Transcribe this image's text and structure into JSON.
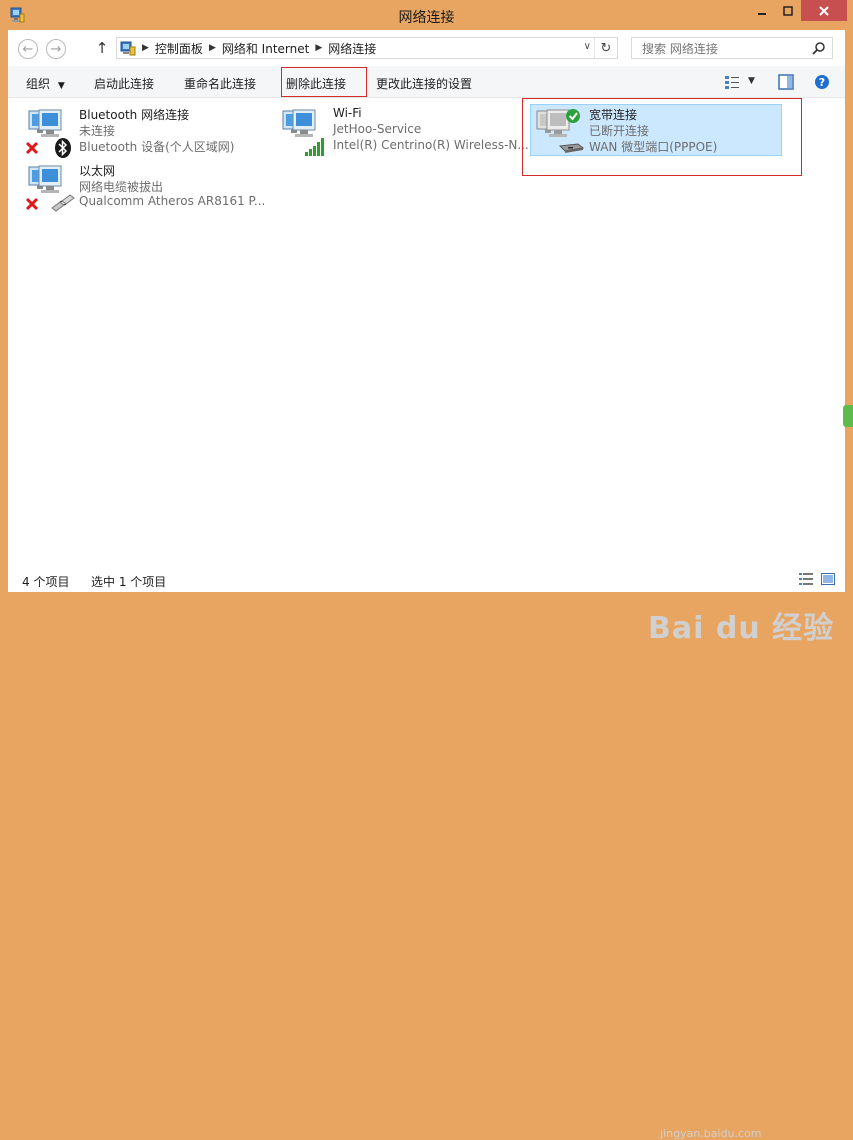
{
  "window": {
    "title": "网络连接"
  },
  "addressbar": {
    "breadcrumbs": [
      "控制面板",
      "网络和 Internet",
      "网络连接"
    ]
  },
  "search": {
    "placeholder": "搜索 网络连接"
  },
  "toolbar": {
    "organize": "组织",
    "start_connection": "启动此连接",
    "rename_connection": "重命名此连接",
    "delete_connection": "删除此连接",
    "change_settings": "更改此连接的设置"
  },
  "connections": [
    {
      "name": "Bluetooth 网络连接",
      "status": "未连接",
      "device": "Bluetooth 设备(个人区域网)",
      "icon": "bluetooth-icon",
      "state": "disconnected"
    },
    {
      "name": "Wi-Fi",
      "status": "JetHoo-Service",
      "device": "Intel(R) Centrino(R) Wireless-N...",
      "icon": "wifi-signal-icon",
      "state": "connected"
    },
    {
      "name": "宽带连接",
      "status": "已断开连接",
      "device": "WAN 微型端口(PPPOE)",
      "icon": "modem-icon",
      "state": "selected"
    },
    {
      "name": "以太网",
      "status": "网络电缆被拔出",
      "device": "Qualcomm Atheros AR8161 P...",
      "icon": "ethernet-cable-icon",
      "state": "disconnected"
    }
  ],
  "statusbar": {
    "item_count": "4 个项目",
    "selected_count": "选中 1 个项目"
  },
  "watermark": {
    "text": "Bai du 经验",
    "sub": "jingyan.baidu.com"
  },
  "colors": {
    "frame": "#e8a562",
    "selection": "#cce8ff",
    "highlight_border": "#d42b2b",
    "close": "#c74f4f"
  }
}
